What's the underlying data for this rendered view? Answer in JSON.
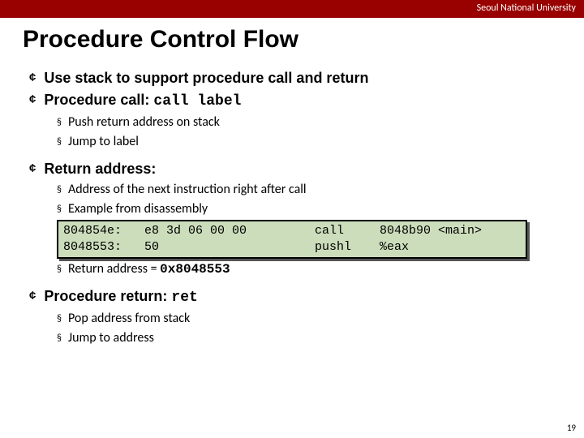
{
  "header": {
    "org": "Seoul National University"
  },
  "title": "Procedure Control Flow",
  "bullets": {
    "b1": "Use stack to support procedure call and return",
    "b2_pre": "Procedure call: ",
    "b2_code": "call label",
    "b2_sub1": "Push return address on stack",
    "b2_sub2_pre": "Jump to ",
    "b2_sub2_code": "label",
    "b3": "Return address:",
    "b3_sub1": "Address of the next instruction right after call",
    "b3_sub2": "Example from disassembly",
    "b3_sub3_pre": "Return address = ",
    "b3_sub3_code": "0x8048553",
    "b4_pre": "Procedure return: ",
    "b4_code": "ret",
    "b4_sub1": "Pop address from stack",
    "b4_sub2": "Jump to address"
  },
  "code": {
    "l1_addr": "804854e:",
    "l1_bytes": "e8 3d 06 00 00",
    "l1_instr": "call",
    "l1_arg": "8048b90 <main>",
    "l2_addr": "8048553:",
    "l2_bytes": "50",
    "l2_instr": "pushl",
    "l2_arg": "%eax"
  },
  "page": "19"
}
